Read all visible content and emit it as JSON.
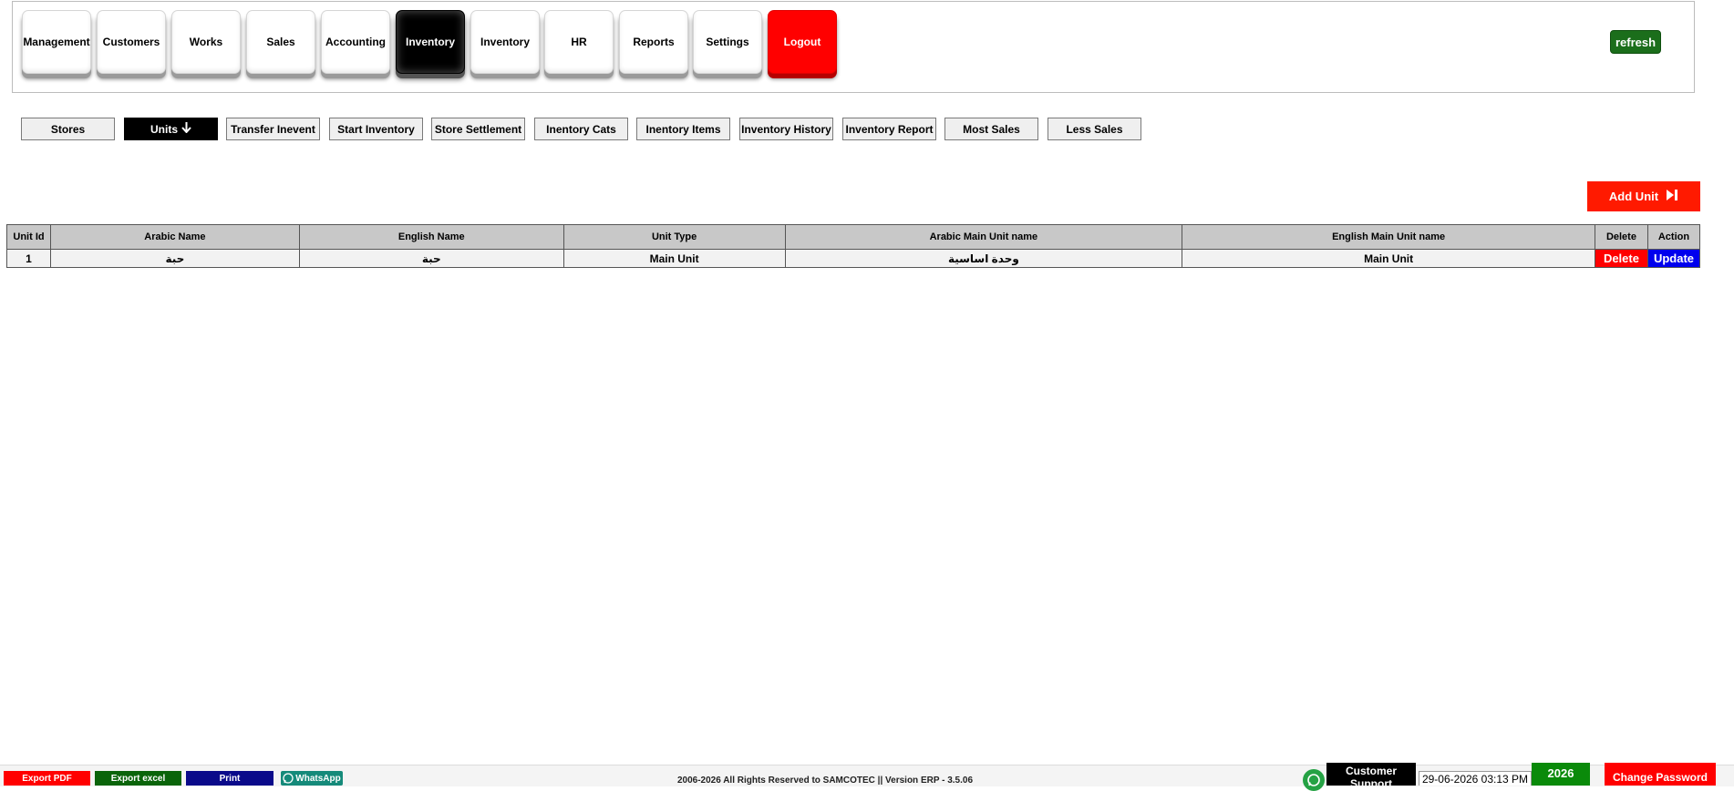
{
  "main_menu": [
    {
      "label": "Management",
      "state": "normal"
    },
    {
      "label": "Customers",
      "state": "normal"
    },
    {
      "label": "Works",
      "state": "normal"
    },
    {
      "label": "Sales",
      "state": "normal"
    },
    {
      "label": "Accounting",
      "state": "normal"
    },
    {
      "label": "Inventory",
      "state": "active"
    },
    {
      "label": "Inventory",
      "state": "normal"
    },
    {
      "label": "HR",
      "state": "normal"
    },
    {
      "label": "Reports",
      "state": "normal"
    },
    {
      "label": "Settings",
      "state": "normal"
    },
    {
      "label": "Logout",
      "state": "logout"
    }
  ],
  "refresh_label": "refresh",
  "sub_menu": [
    {
      "label": "Stores"
    },
    {
      "label": "Units",
      "active": true,
      "icon": "arrow-down-icon"
    },
    {
      "label": "Transfer Inevent"
    },
    {
      "label": "Start Inventory"
    },
    {
      "label": "Store Settlement"
    },
    {
      "label": "Inentory Cats"
    },
    {
      "label": "Inentory Items"
    },
    {
      "label": "Inventory History"
    },
    {
      "label": "Inventory Report"
    },
    {
      "label": "Most Sales"
    },
    {
      "label": "Less Sales"
    }
  ],
  "add_unit_label": "Add Unit",
  "table": {
    "headers": [
      "Unit Id",
      "Arabic Name",
      "English Name",
      "Unit Type",
      "Arabic Main Unit name",
      "English Main Unit name",
      "Delete",
      "Action"
    ],
    "rows": [
      {
        "id": "1",
        "arabic_name": "حبة",
        "english_name": "حبة",
        "unit_type": "Main Unit",
        "arabic_main": "وحدة اساسية",
        "english_main": "Main Unit",
        "delete_label": "Delete",
        "action_label": "Update"
      }
    ]
  },
  "footer": {
    "export_pdf": "Export PDF",
    "export_excel": "Export excel",
    "print": "Print",
    "whatsapp": "WhatsApp",
    "copyright": "2006-2026 All Rights Reserved to SAMCOTEC || Version ERP - 3.5.06",
    "customer_support": "Customer Support",
    "datetime": "29-06-2026 03:13 PM",
    "year": "2026",
    "change_password": "Change Password"
  },
  "colors": {
    "danger": "#ff0000",
    "primary_blue": "#0000ee",
    "green": "#1b6e1b",
    "active": "#000000"
  }
}
